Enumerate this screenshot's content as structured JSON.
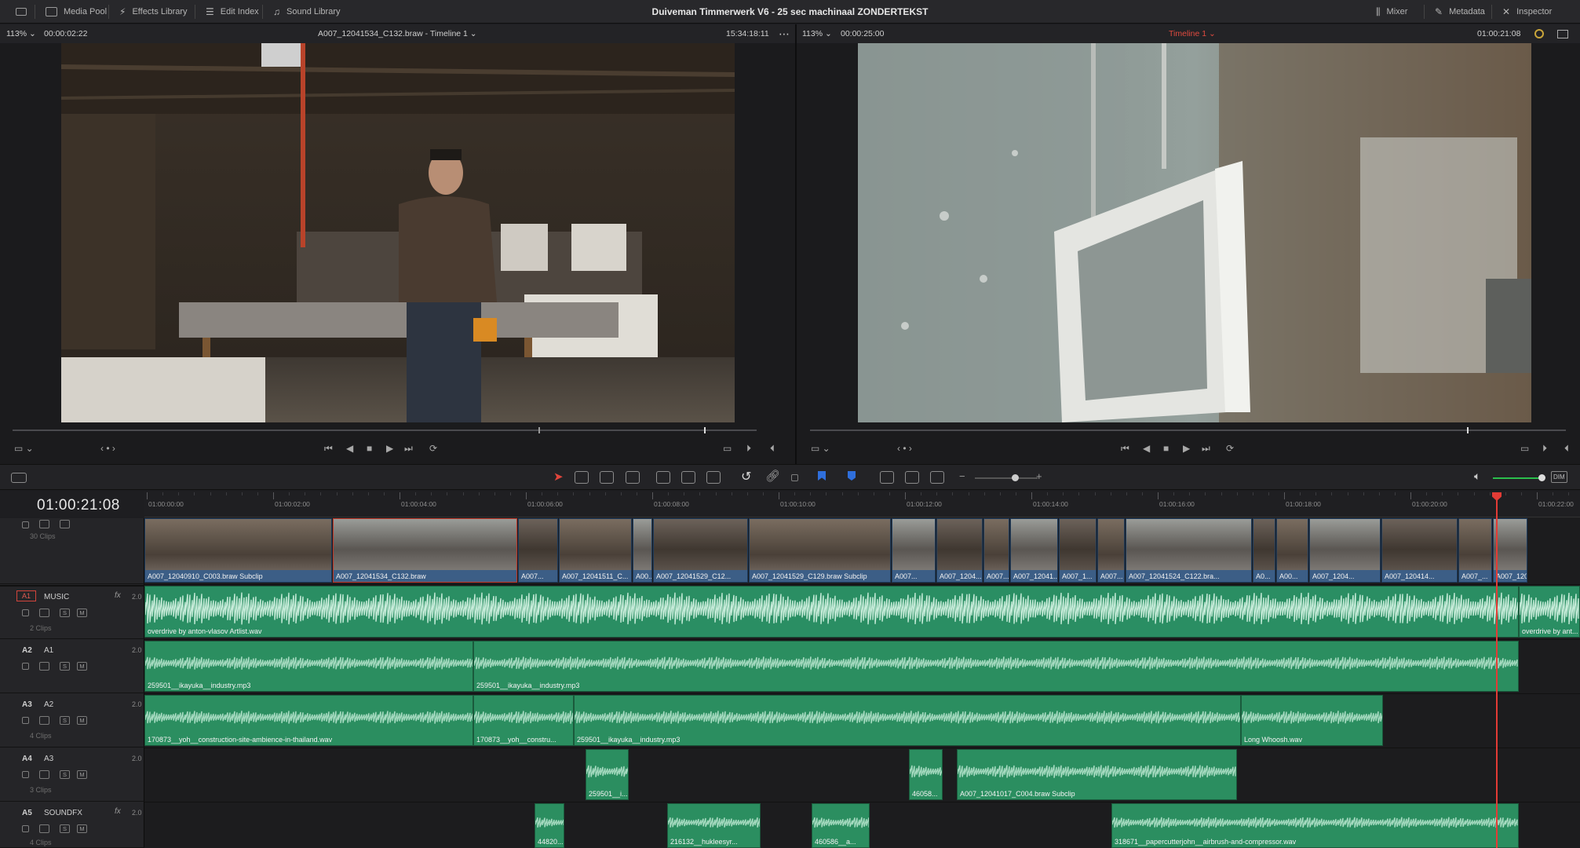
{
  "topbar": {
    "media_pool": "Media Pool",
    "effects_library": "Effects Library",
    "edit_index": "Edit Index",
    "sound_library": "Sound Library",
    "project_title": "Duiveman Timmerwerk V6 - 25 sec machinaal ZONDERTEKST",
    "mixer": "Mixer",
    "metadata": "Metadata",
    "inspector": "Inspector"
  },
  "source_viewer": {
    "zoom": "113%",
    "duration": "00:00:02:22",
    "clip_name": "A007_12041534_C132.braw - Timeline 1",
    "timecode": "15:34:18:11"
  },
  "timeline_viewer": {
    "zoom": "113%",
    "duration": "00:00:25:00",
    "timeline_name": "Timeline 1",
    "timecode": "01:00:21:08"
  },
  "timeline": {
    "current_timecode": "01:00:21:08",
    "ruler_ticks": [
      "01:00:00:00",
      "01:00:02:00",
      "01:00:04:00",
      "01:00:06:00",
      "01:00:08:00",
      "01:00:10:00",
      "01:00:12:00",
      "01:00:14:00",
      "01:00:16:00",
      "01:00:18:00",
      "01:00:20:00",
      "01:00:22:00"
    ],
    "playhead_position": 0.927
  },
  "tracks": {
    "video": {
      "clip_count": "30 Clips"
    },
    "a1": {
      "patch": "A1",
      "id": "A1",
      "name": "MUSIC",
      "fx": "fx",
      "volume": "2.0",
      "clip_count": "2 Clips"
    },
    "a2": {
      "id": "A2",
      "name": "A1",
      "volume": "2.0"
    },
    "a3": {
      "id": "A3",
      "name": "A2",
      "volume": "2.0",
      "clip_count": "4 Clips"
    },
    "a4": {
      "id": "A4",
      "name": "A3",
      "volume": "2.0",
      "clip_count": "3 Clips"
    },
    "a5": {
      "id": "A5",
      "name": "SOUNDFX",
      "fx": "fx",
      "volume": "2.0",
      "clip_count": "4 Clips"
    },
    "lock_icon": "lock-icon",
    "solo": "S",
    "mute": "M"
  },
  "video_clips": [
    "A007_12040910_C003.braw Subclip",
    "A007_12041534_C132.braw",
    "A007...",
    "A007_12041511_C...",
    "A00...",
    "A007_12041529_C12...",
    "A007_12041529_C129.braw Subclip",
    "A007...",
    "A007_1204...",
    "A007...",
    "A007_12041...",
    "A007_1...",
    "A007...",
    "A007_12041524_C122.bra...",
    "A0...",
    "A00...",
    "A007_1204...",
    "A007_120414...",
    "A007_...",
    "A007_1204..."
  ],
  "audio_clips": {
    "music_1": "overdrive by anton-vlasov Artlist.wav",
    "music_2": "overdrive by ant...",
    "a2_1": "259501__ikayuka__industry.mp3",
    "a2_2": "259501__ikayuka__industry.mp3",
    "a3_1": "170873__yoh__construction-site-ambience-in-thailand.wav",
    "a3_2": "170873__yoh__constru...",
    "a3_3": "259501__ikayuka__industry.mp3",
    "a3_4": "Long Whoosh.wav",
    "a4_1": "259501__i...",
    "a4_2": "46058...",
    "a4_3": "A007_12041017_C004.braw Subclip",
    "a5_1": "44820...",
    "a5_2": "216132__hukleesyr...",
    "a5_3": "460586__a...",
    "a5_4": "318671__papercutterjohn__airbrush-and-compressor.wav"
  },
  "colors": {
    "video_clip": "#3c5e86",
    "audio_clip": "#2b8e60",
    "playhead": "#e33b35",
    "timeline_name": "#e04a3f"
  }
}
